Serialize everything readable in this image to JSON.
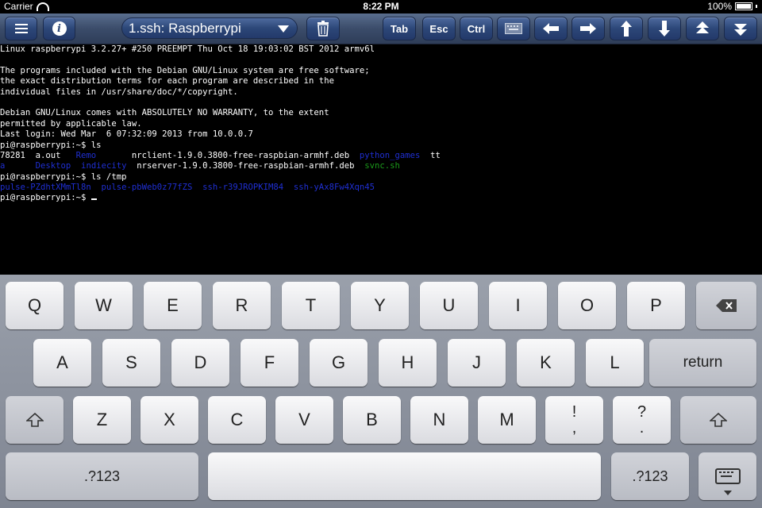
{
  "status_bar": {
    "carrier": "Carrier",
    "time": "8:22 PM",
    "battery": "100%"
  },
  "toolbar": {
    "session_title": "1.ssh: Raspberrypi",
    "buttons": {
      "tab": "Tab",
      "esc": "Esc",
      "ctrl": "Ctrl"
    },
    "icons": [
      "menu-icon",
      "info-icon",
      "trash-icon",
      "keyboard-icon",
      "arrow-left-icon",
      "arrow-right-icon",
      "arrow-up-icon",
      "arrow-down-icon",
      "page-up-icon",
      "page-down-icon"
    ],
    "colors": {
      "button": "#2c4778",
      "bar": "#3b4c6a"
    }
  },
  "terminal": {
    "lines": [
      "Linux raspberrypi 3.2.27+ #250 PREEMPT Thu Oct 18 19:03:02 BST 2012 armv6l",
      "",
      "The programs included with the Debian GNU/Linux system are free software;",
      "the exact distribution terms for each program are described in the",
      "individual files in /usr/share/doc/*/copyright.",
      "",
      "Debian GNU/Linux comes with ABSOLUTELY NO WARRANTY, to the extent",
      "permitted by applicable law.",
      "Last login: Wed Mar  6 07:32:09 2013 from 10.0.0.7",
      "pi@raspberrypi:~$ ls"
    ],
    "ls_row1": {
      "a": "78281  a.out   ",
      "b": "Remo",
      "c": "       nrclient-1.9.0.3800-free-raspbian-armhf.deb  ",
      "d": "python_games",
      "e": "  tt"
    },
    "ls_row2": {
      "a": "a",
      "b": "      Desktop  indiecity",
      "c": "  nrserver-1.9.0.3800-free-raspbian-armhf.deb  ",
      "d": "svnc.sh"
    },
    "cmd_tmp": "pi@raspberrypi:~$ ls /tmp",
    "tmp_row": "pulse-PZdhtXMmTl8n  pulse-pbWeb0z77fZS  ssh-r39JROPKIM84  ssh-yAx8Fw4Xqn45",
    "prompt": "pi@raspberrypi:~$ ",
    "colors": {
      "background": "#000000",
      "text": "#ffffff",
      "directory": "#1f2fd2",
      "executable": "#1b9a1b"
    }
  },
  "keyboard": {
    "row1": [
      "Q",
      "W",
      "E",
      "R",
      "T",
      "Y",
      "U",
      "I",
      "O",
      "P"
    ],
    "row2": [
      "A",
      "S",
      "D",
      "F",
      "G",
      "H",
      "J",
      "K",
      "L"
    ],
    "row3": [
      "Z",
      "X",
      "C",
      "V",
      "B",
      "N",
      "M"
    ],
    "return_label": "return",
    "punct1_top": "!",
    "punct1_bottom": ",",
    "punct2_top": "?",
    "punct2_bottom": ".",
    "numbers_label": ".?123",
    "icons": [
      "backspace-icon",
      "shift-icon",
      "dismiss-keyboard-icon"
    ]
  }
}
